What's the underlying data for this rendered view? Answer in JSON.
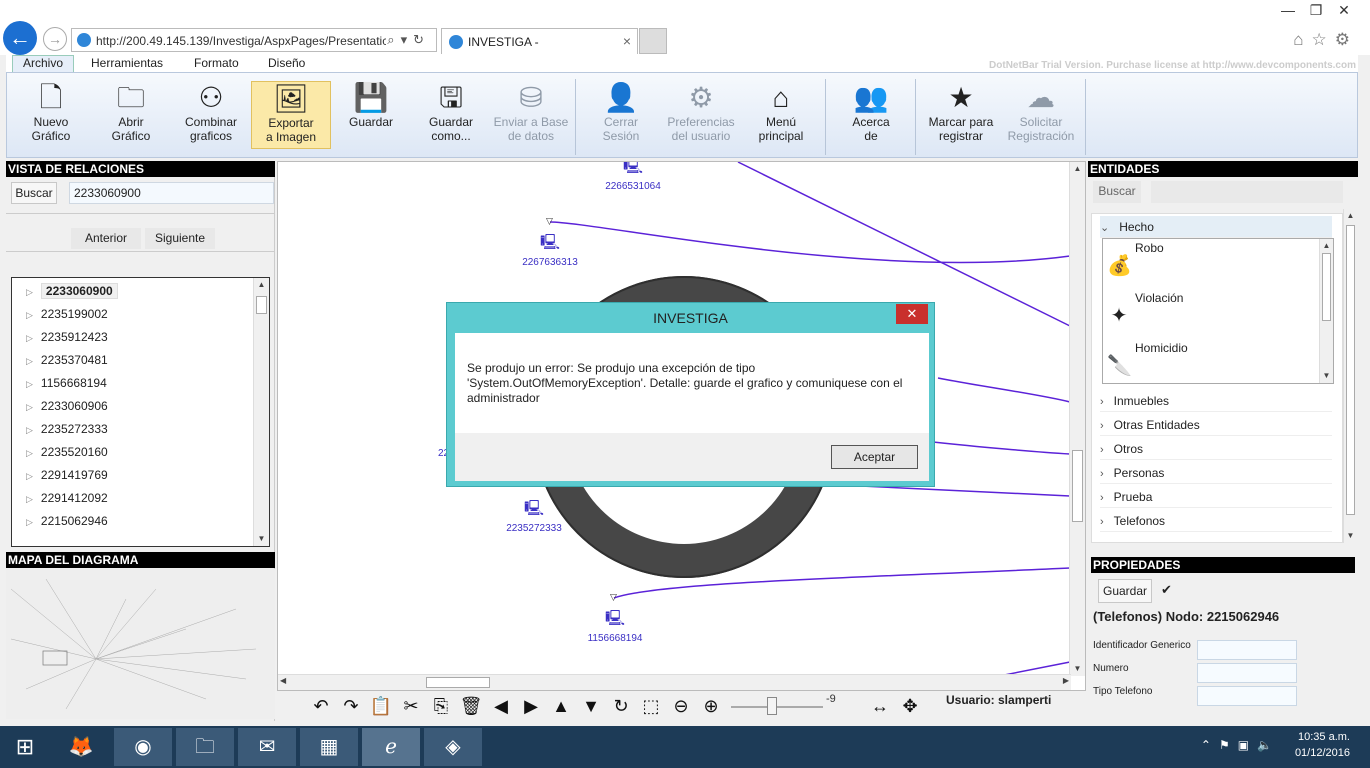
{
  "browser": {
    "url": "http://200.49.145.139/Investiga/AspxPages/Presentatic",
    "tab_title": "INVESTIGA -",
    "window_controls": [
      "—",
      "❐",
      "✕"
    ]
  },
  "menu": {
    "tabs": [
      "Archivo",
      "Herramientas",
      "Formato",
      "Diseño"
    ],
    "trial_note": "DotNetBar Trial Version. Purchase license at http://www.devcomponents.com"
  },
  "ribbon": {
    "buttons": [
      {
        "label1": "Nuevo",
        "label2": "Gráfico",
        "icon": "new-file-icon",
        "glyph": "🗋"
      },
      {
        "label1": "Abrir",
        "label2": "Gráfico",
        "icon": "folder-icon",
        "glyph": "🗀"
      },
      {
        "label1": "Combinar",
        "label2": "graficos",
        "icon": "network-icon",
        "glyph": "⚇"
      },
      {
        "label1": "Exportar",
        "label2": "a Imagen",
        "icon": "image-icon",
        "glyph": "🖼"
      },
      {
        "label1": "Guardar",
        "label2": "",
        "icon": "save-icon",
        "glyph": "💾"
      },
      {
        "label1": "Guardar",
        "label2": "como...",
        "icon": "save-as-icon",
        "glyph": "🖫"
      },
      {
        "label1": "Enviar a Base",
        "label2": "de datos",
        "icon": "database-icon",
        "glyph": "⛁"
      },
      {
        "label1": "Cerrar",
        "label2": "Sesión",
        "icon": "user-icon",
        "glyph": "👤"
      },
      {
        "label1": "Preferencias",
        "label2": "del usuario",
        "icon": "gear-icon",
        "glyph": "⚙"
      },
      {
        "label1": "Menú",
        "label2": "principal",
        "icon": "home-icon",
        "glyph": "⌂"
      },
      {
        "label1": "Acerca",
        "label2": "de",
        "icon": "group-icon",
        "glyph": "👥"
      },
      {
        "label1": "Marcar para",
        "label2": "registrar",
        "icon": "star-icon",
        "glyph": "★"
      },
      {
        "label1": "Solicitar",
        "label2": "Registración",
        "icon": "cloud-upload-icon",
        "glyph": "☁"
      }
    ]
  },
  "left": {
    "relations_title": "VISTA DE RELACIONES",
    "search_button": "Buscar",
    "search_value": "2233060900",
    "prev_button": "Anterior",
    "next_button": "Siguiente",
    "tree_items": [
      "2233060900",
      "2235199002",
      "2235912423",
      "2235370481",
      "1156668194",
      "2233060906",
      "2235272333",
      "2235520160",
      "2291419769",
      "2291412092",
      "2215062946"
    ],
    "map_title": "MAPA DEL DIAGRAMA"
  },
  "canvas": {
    "nodes": [
      "2266531064",
      "2267636313",
      "2235272333",
      "1156668194"
    ],
    "partial_label": "22"
  },
  "toolbar": {
    "zoom_value": "-9",
    "user_label": "Usuario: slamperti"
  },
  "entities": {
    "title": "ENTIDADES",
    "search_button": "Buscar",
    "open_category": "Hecho",
    "hecho_items": [
      {
        "label": "Robo",
        "icon": "money-bag-icon"
      },
      {
        "label": "Violación",
        "icon": "sparkle-icon"
      },
      {
        "label": "Homicidio",
        "icon": "knife-icon"
      }
    ],
    "categories": [
      "Inmuebles",
      "Otras Entidades",
      "Otros",
      "Personas",
      "Prueba",
      "Telefonos"
    ]
  },
  "properties": {
    "title": "PROPIEDADES",
    "save_button": "Guardar",
    "node_title": "(Telefonos) Nodo: 2215062946",
    "fields": [
      "Identificador Generico",
      "Numero",
      "Tipo Telefono"
    ]
  },
  "dialog": {
    "title": "INVESTIGA",
    "message": "Se produjo un error: Se produjo una excepción de tipo 'System.OutOfMemoryException'. Detalle: guarde el grafico y comuniquese con el administrador",
    "ok_button": "Aceptar"
  },
  "taskbar": {
    "time": "10:35 a.m.",
    "date": "01/12/2016"
  },
  "colors": {
    "edge": "#5b22d8",
    "node": "#3a2fc4",
    "dialog_frame": "#5ccbd0",
    "taskbar": "#1d3b57"
  }
}
